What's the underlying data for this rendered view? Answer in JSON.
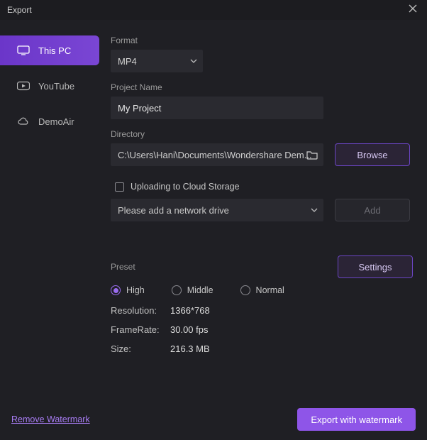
{
  "window": {
    "title": "Export"
  },
  "sidebar": {
    "items": [
      {
        "id": "this-pc",
        "label": "This PC",
        "active": true
      },
      {
        "id": "youtube",
        "label": "YouTube",
        "active": false
      },
      {
        "id": "demoair",
        "label": "DemoAir",
        "active": false
      }
    ]
  },
  "format": {
    "label": "Format",
    "value": "MP4"
  },
  "project": {
    "label": "Project Name",
    "value": "My Project"
  },
  "directory": {
    "label": "Directory",
    "path": "C:\\Users\\Hani\\Documents\\Wondershare Dem...",
    "browse_label": "Browse"
  },
  "cloud": {
    "upload_label": "Uploading to Cloud Storage",
    "checked": false,
    "placeholder": "Please add a network drive",
    "add_label": "Add",
    "add_enabled": false
  },
  "preset": {
    "label": "Preset",
    "settings_label": "Settings",
    "options": [
      {
        "id": "high",
        "label": "High",
        "selected": true
      },
      {
        "id": "middle",
        "label": "Middle",
        "selected": false
      },
      {
        "id": "normal",
        "label": "Normal",
        "selected": false
      }
    ],
    "info": {
      "resolution_label": "Resolution:",
      "resolution_value": "1366*768",
      "framerate_label": "FrameRate:",
      "framerate_value": "30.00 fps",
      "size_label": "Size:",
      "size_value": "216.3 MB"
    }
  },
  "footer": {
    "remove_watermark": "Remove Watermark",
    "export_label": "Export with watermark"
  },
  "colors": {
    "accent": "#8e55e8",
    "bg": "#1f1f24",
    "input_bg": "#2a2a30"
  }
}
